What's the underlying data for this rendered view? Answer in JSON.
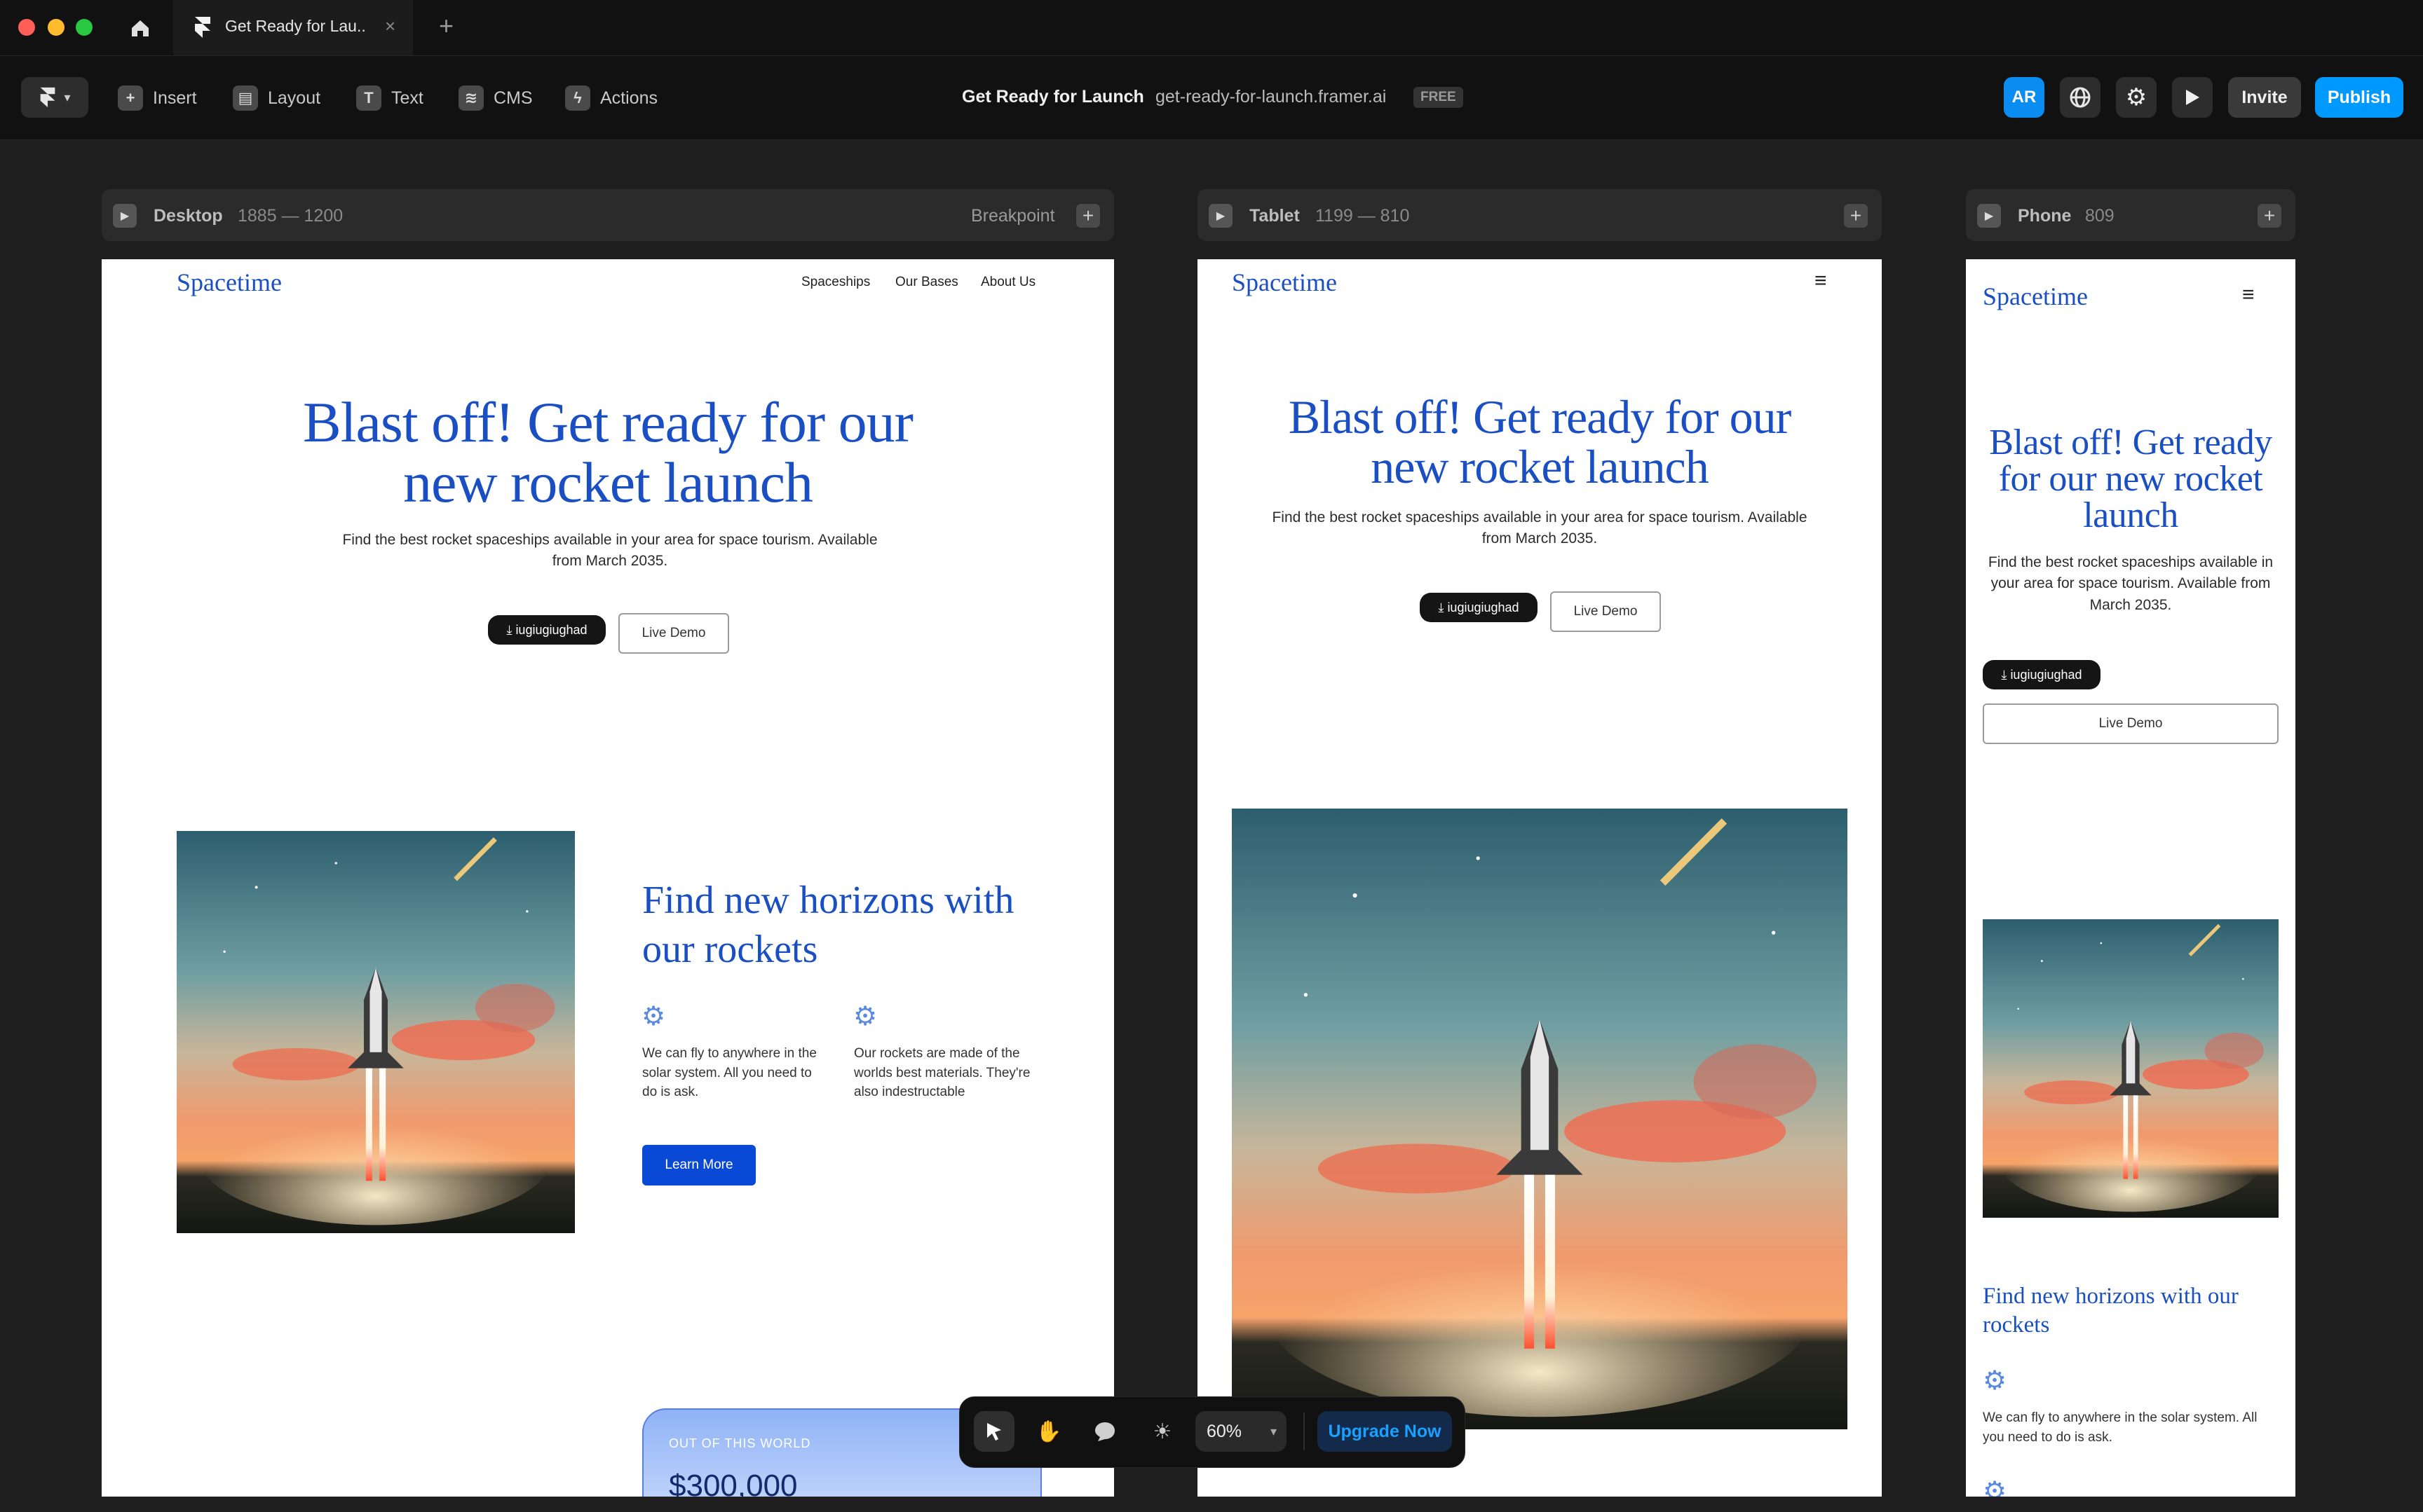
{
  "window": {
    "tab_title": "Get Ready for Lau..",
    "tab_close": "×",
    "new_tab": "+",
    "traffic": {
      "red": "#ff5f57",
      "yellow": "#febc2e",
      "green": "#28c840"
    }
  },
  "toolbar": {
    "insert": "Insert",
    "layout": "Layout",
    "text": "Text",
    "cms": "CMS",
    "actions": "Actions",
    "project_title": "Get Ready for Launch",
    "separator": "·",
    "project_url": "get-ready-for-launch.framer.ai",
    "plan_badge": "FREE",
    "avatar": "AR",
    "invite": "Invite",
    "publish": "Publish",
    "accent": "#0099ff"
  },
  "frames": {
    "desktop": {
      "name": "Desktop",
      "dims": "1885 — 1200",
      "breakpoint": "Breakpoint",
      "plus": "+"
    },
    "tablet": {
      "name": "Tablet",
      "dims": "1199 — 810",
      "plus": "+"
    },
    "phone": {
      "name": "Phone",
      "dims": "809",
      "plus": "+"
    }
  },
  "site": {
    "logo": "Spacetime",
    "nav": [
      "Spaceships",
      "Our Bases",
      "About Us"
    ],
    "hero_title_desktop": "Blast off! Get ready for our new rocket launch",
    "hero_subtitle": "Find the best rocket spaceships available in your area for space tourism. Available from March 2035.",
    "download_label": "iugiugiughad",
    "download_icon": "⤓",
    "live_demo": "Live Demo",
    "section_title": "Find new horizons with our rockets",
    "feature1": "We can fly to anywhere in the solar system. All you need to do is ask.",
    "feature2": "Our rockets are made of the worlds best materials. They're also indestructable",
    "learn_more": "Learn More",
    "pricing_kicker": "OUT OF THIS WORLD",
    "pricing_value": "$300,000",
    "brand_color": "#1a4fc4",
    "menu_icon": "≡",
    "gear_icon": "⚙"
  },
  "bottombar": {
    "zoom": "60%",
    "upgrade": "Upgrade Now"
  }
}
